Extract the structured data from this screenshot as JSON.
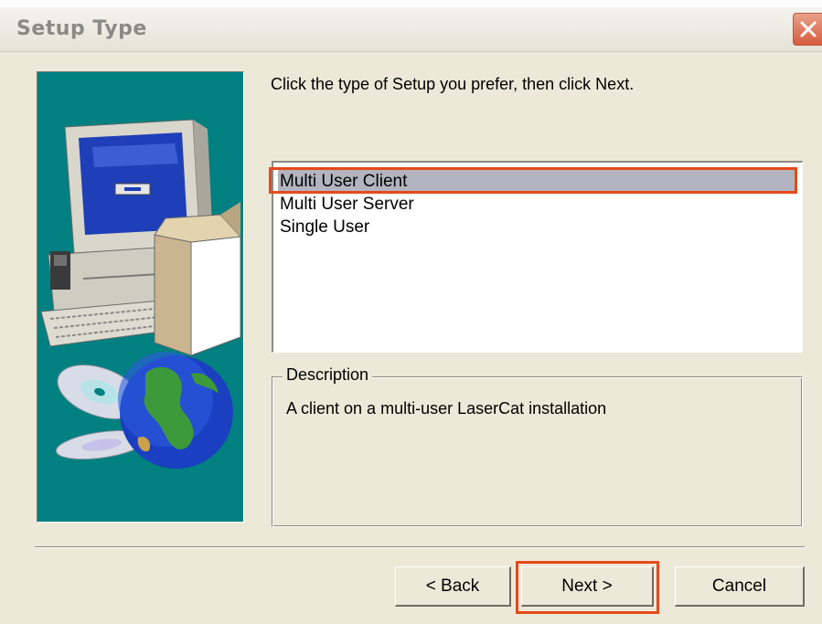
{
  "window": {
    "title": "Setup Type",
    "close_icon": "close-icon"
  },
  "main": {
    "prompt": "Click the type of Setup you prefer, then click Next.",
    "setup_types": [
      {
        "label": "Multi User Client",
        "selected": true
      },
      {
        "label": "Multi User Server",
        "selected": false
      },
      {
        "label": "Single User",
        "selected": false
      }
    ],
    "description": {
      "legend": "Description",
      "text": "A client on a multi-user LaserCat installation"
    }
  },
  "buttons": {
    "back": "< Back",
    "next": "Next >",
    "cancel": "Cancel"
  },
  "colors": {
    "side_panel": "#008080",
    "highlight": "#e64a19",
    "selection": "#b2b4bf"
  }
}
